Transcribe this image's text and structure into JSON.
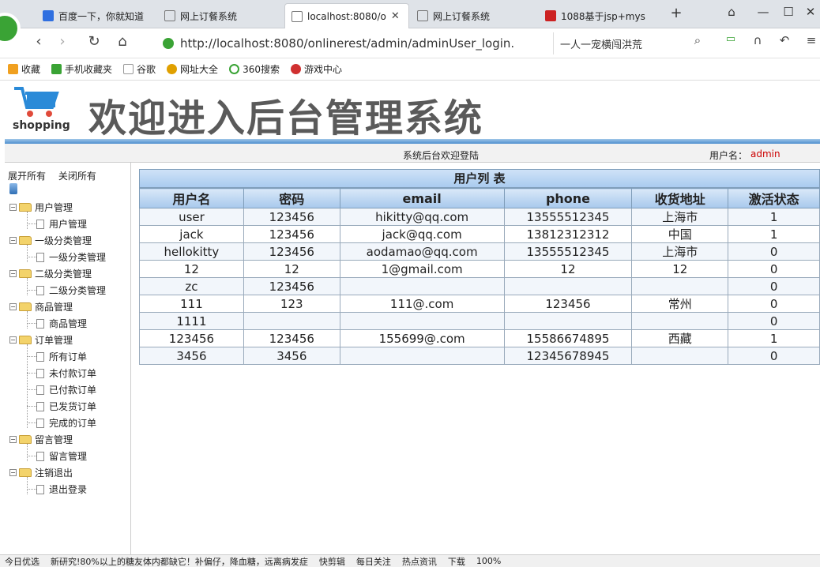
{
  "browser": {
    "tabs": [
      {
        "label": "百度一下，你就知道",
        "active": false,
        "color": "#2f6fe0"
      },
      {
        "label": "网上订餐系统",
        "active": false,
        "color": "#777777"
      },
      {
        "label": "localhost:8080/o",
        "active": true,
        "color": "#777777"
      },
      {
        "label": "网上订餐系统",
        "active": false,
        "color": "#777777"
      },
      {
        "label": "1088基于jsp+mys",
        "active": false,
        "color": "#cc2222"
      }
    ],
    "new_tab_icon": "plus-icon",
    "url": "http://localhost:8080/onlinerest/admin/adminUser_login.",
    "search_text": "一人一宠横闯洪荒"
  },
  "bookmarks": [
    {
      "label": "收藏",
      "icon": "star-icon",
      "color": "#f0a020"
    },
    {
      "label": "手机收藏夹",
      "icon": "phone-icon",
      "color": "#3aa335"
    },
    {
      "label": "谷歌",
      "icon": "page-icon",
      "color": "#999999"
    },
    {
      "label": "网址大全",
      "icon": "globe-icon",
      "color": "#e0a000"
    },
    {
      "label": "360搜索",
      "icon": "search-icon",
      "color": "#3aa335"
    },
    {
      "label": "游戏中心",
      "icon": "game-icon",
      "color": "#d03030"
    }
  ],
  "header": {
    "logo_text": "shopping",
    "title": "欢迎进入后台管理系统",
    "welcome": "系统后台欢迎登陆",
    "user_label": "用户名：",
    "user_name": "admin"
  },
  "sidebar": {
    "expand_all": "展开所有",
    "collapse_all": "关闭所有",
    "groups": [
      {
        "label": "用户管理",
        "items": [
          "用户管理"
        ]
      },
      {
        "label": "一级分类管理",
        "items": [
          "一级分类管理"
        ]
      },
      {
        "label": "二级分类管理",
        "items": [
          "二级分类管理"
        ]
      },
      {
        "label": "商品管理",
        "items": [
          "商品管理"
        ]
      },
      {
        "label": "订单管理",
        "items": [
          "所有订单",
          "未付款订单",
          "已付款订单",
          "已发货订单",
          "完成的订单"
        ]
      },
      {
        "label": "留言管理",
        "items": [
          "留言管理"
        ]
      },
      {
        "label": "注销退出",
        "items": [
          "退出登录"
        ]
      }
    ]
  },
  "table": {
    "title": "用户列 表",
    "columns": [
      "用户名",
      "密码",
      "email",
      "phone",
      "收货地址",
      "激活状态"
    ],
    "rows": [
      [
        "user",
        "123456",
        "hikitty@qq.com",
        "13555512345",
        "上海市",
        "1"
      ],
      [
        "jack",
        "123456",
        "jack@qq.com",
        "13812312312",
        "中国",
        "1"
      ],
      [
        "hellokitty",
        "123456",
        "aodamao@qq.com",
        "13555512345",
        "上海市",
        "0"
      ],
      [
        "12",
        "12",
        "1@gmail.com",
        "12",
        "12",
        "0"
      ],
      [
        "zc",
        "123456",
        "",
        "",
        "",
        "0"
      ],
      [
        "111",
        "123",
        "111@.com",
        "123456",
        "常州",
        "0"
      ],
      [
        "1111",
        "",
        "",
        "",
        "",
        "0"
      ],
      [
        "123456",
        "123456",
        "155699@.com",
        "15586674895",
        "西藏",
        "1"
      ],
      [
        "3456",
        "3456",
        "",
        "12345678945",
        "",
        "0"
      ]
    ]
  },
  "statusbar": {
    "items": [
      "今日优选",
      "新研究!80%以上的糖友体内都缺它！补偏仔，降血糖，远离病发症",
      "快剪辑",
      "每日关注",
      "热点资讯",
      "下载",
      "100%"
    ]
  }
}
